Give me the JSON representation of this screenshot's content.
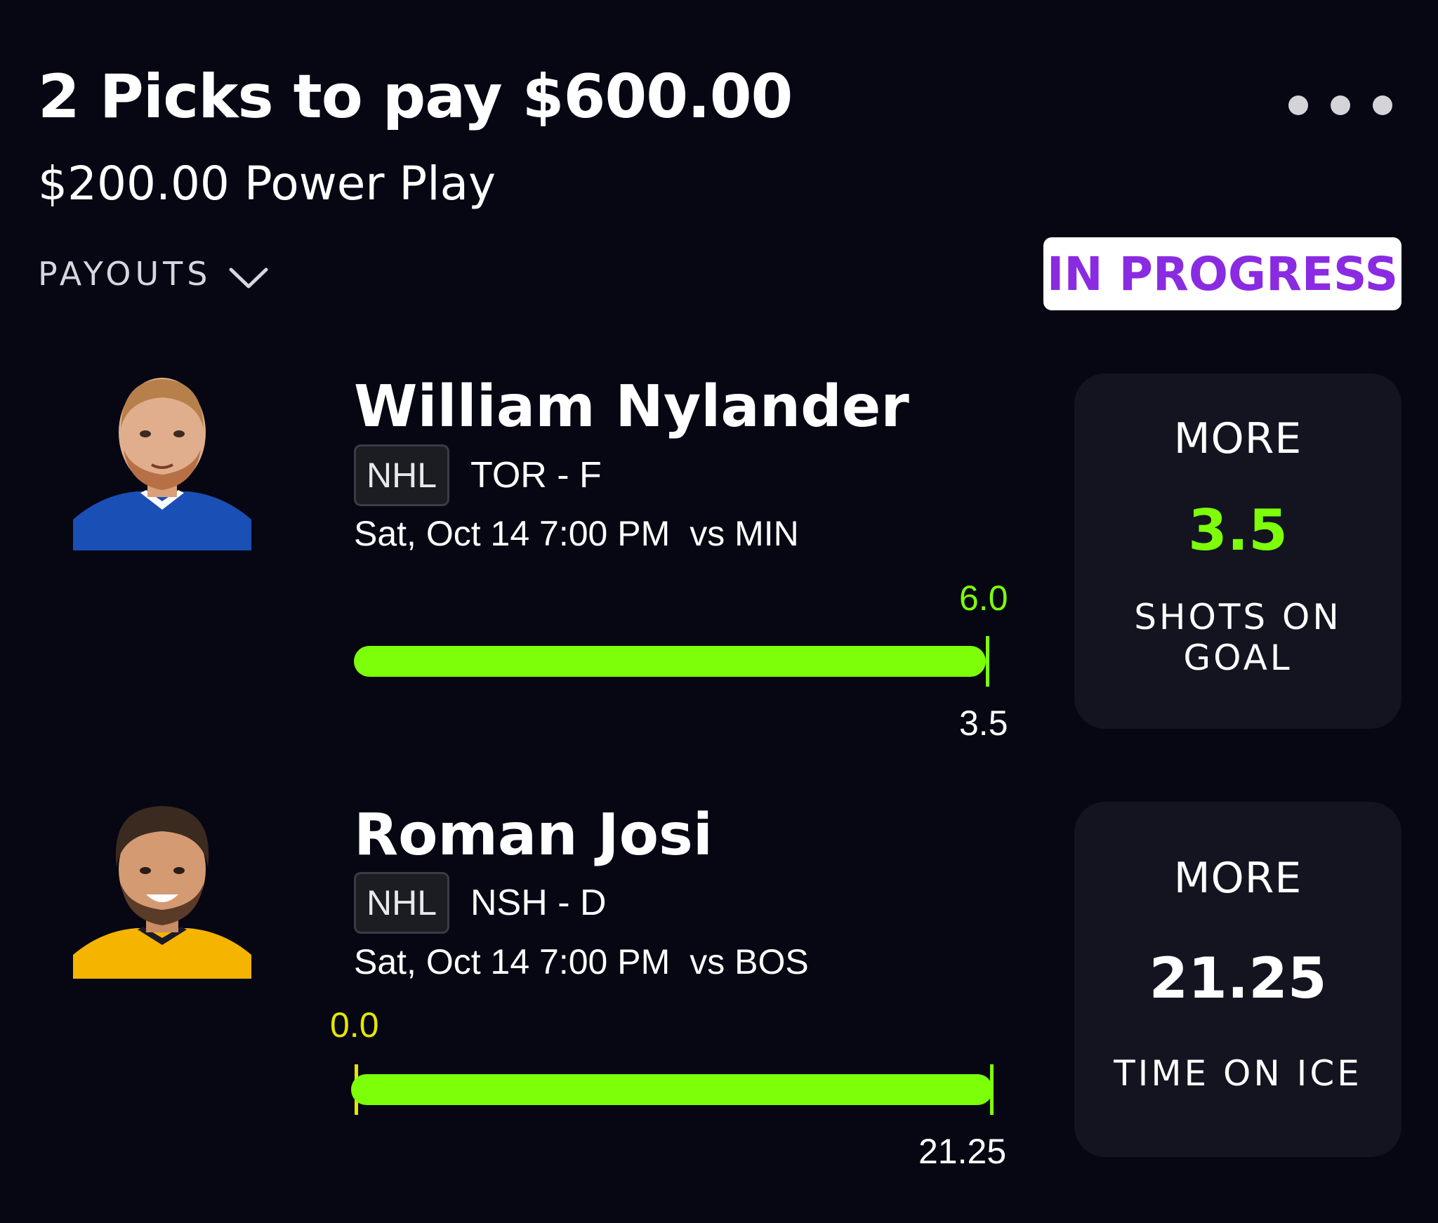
{
  "header": {
    "title": "2 Picks to pay $600.00",
    "subtitle": "$200.00 Power Play",
    "payouts_label": "PAYOUTS",
    "status": "IN PROGRESS"
  },
  "colors": {
    "background": "#060713",
    "accent_green": "#7dff0a",
    "status_purple": "#8a2be2",
    "zero_yellow": "#e6e600"
  },
  "picks": [
    {
      "player": "William Nylander",
      "league": "NHL",
      "team_position": "TOR - F",
      "game_time": "Sat, Oct 14 7:00 PM",
      "opponent": "vs MIN",
      "current_value": "6.0",
      "line_value": "3.5",
      "direction": "MORE",
      "line": "3.5",
      "stat": "SHOTS ON GOAL",
      "jersey_color": "#1a4fb5"
    },
    {
      "player": "Roman Josi",
      "league": "NHL",
      "team_position": "NSH - D",
      "game_time": "Sat, Oct 14 7:00 PM",
      "opponent": "vs BOS",
      "current_value": "0.0",
      "line_value": "21.25",
      "direction": "MORE",
      "line": "21.25",
      "stat": "TIME ON ICE",
      "jersey_color": "#f4b400"
    }
  ]
}
